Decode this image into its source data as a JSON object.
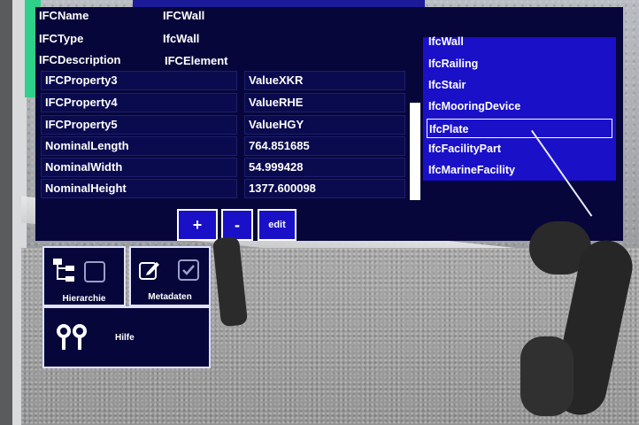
{
  "properties": [
    {
      "key": "IFCName",
      "value": "IFCWall"
    },
    {
      "key": "IFCType",
      "value": "IfcWall"
    },
    {
      "key": "IFCDescription",
      "value": "IFCElement"
    },
    {
      "key": "IFCProperty3",
      "value": "ValueXKR"
    },
    {
      "key": "IFCProperty4",
      "value": "ValueRHE"
    },
    {
      "key": "IFCProperty5",
      "value": "ValueHGY"
    },
    {
      "key": "NominalLength",
      "value": "764.851685"
    },
    {
      "key": "NominalWidth",
      "value": "54.999428"
    },
    {
      "key": "NominalHeight",
      "value": "1377.600098"
    }
  ],
  "type_list": {
    "items": [
      "IfcWall",
      "IfcRailing",
      "IfcStair",
      "IfcMooringDevice",
      "IfcPlate",
      "IfcFacilityPart",
      "IfcMarineFacility"
    ],
    "selected": "IfcPlate"
  },
  "buttons": {
    "add": "+",
    "remove": "-",
    "edit": "edit"
  },
  "tools": {
    "hierarchy": "Hierarchie",
    "metadata": "Metadaten",
    "help": "Hilfe"
  },
  "colors": {
    "panel_bg": "#06063a",
    "accent_blue": "#1a10c8",
    "selection_border": "#ffffff"
  }
}
